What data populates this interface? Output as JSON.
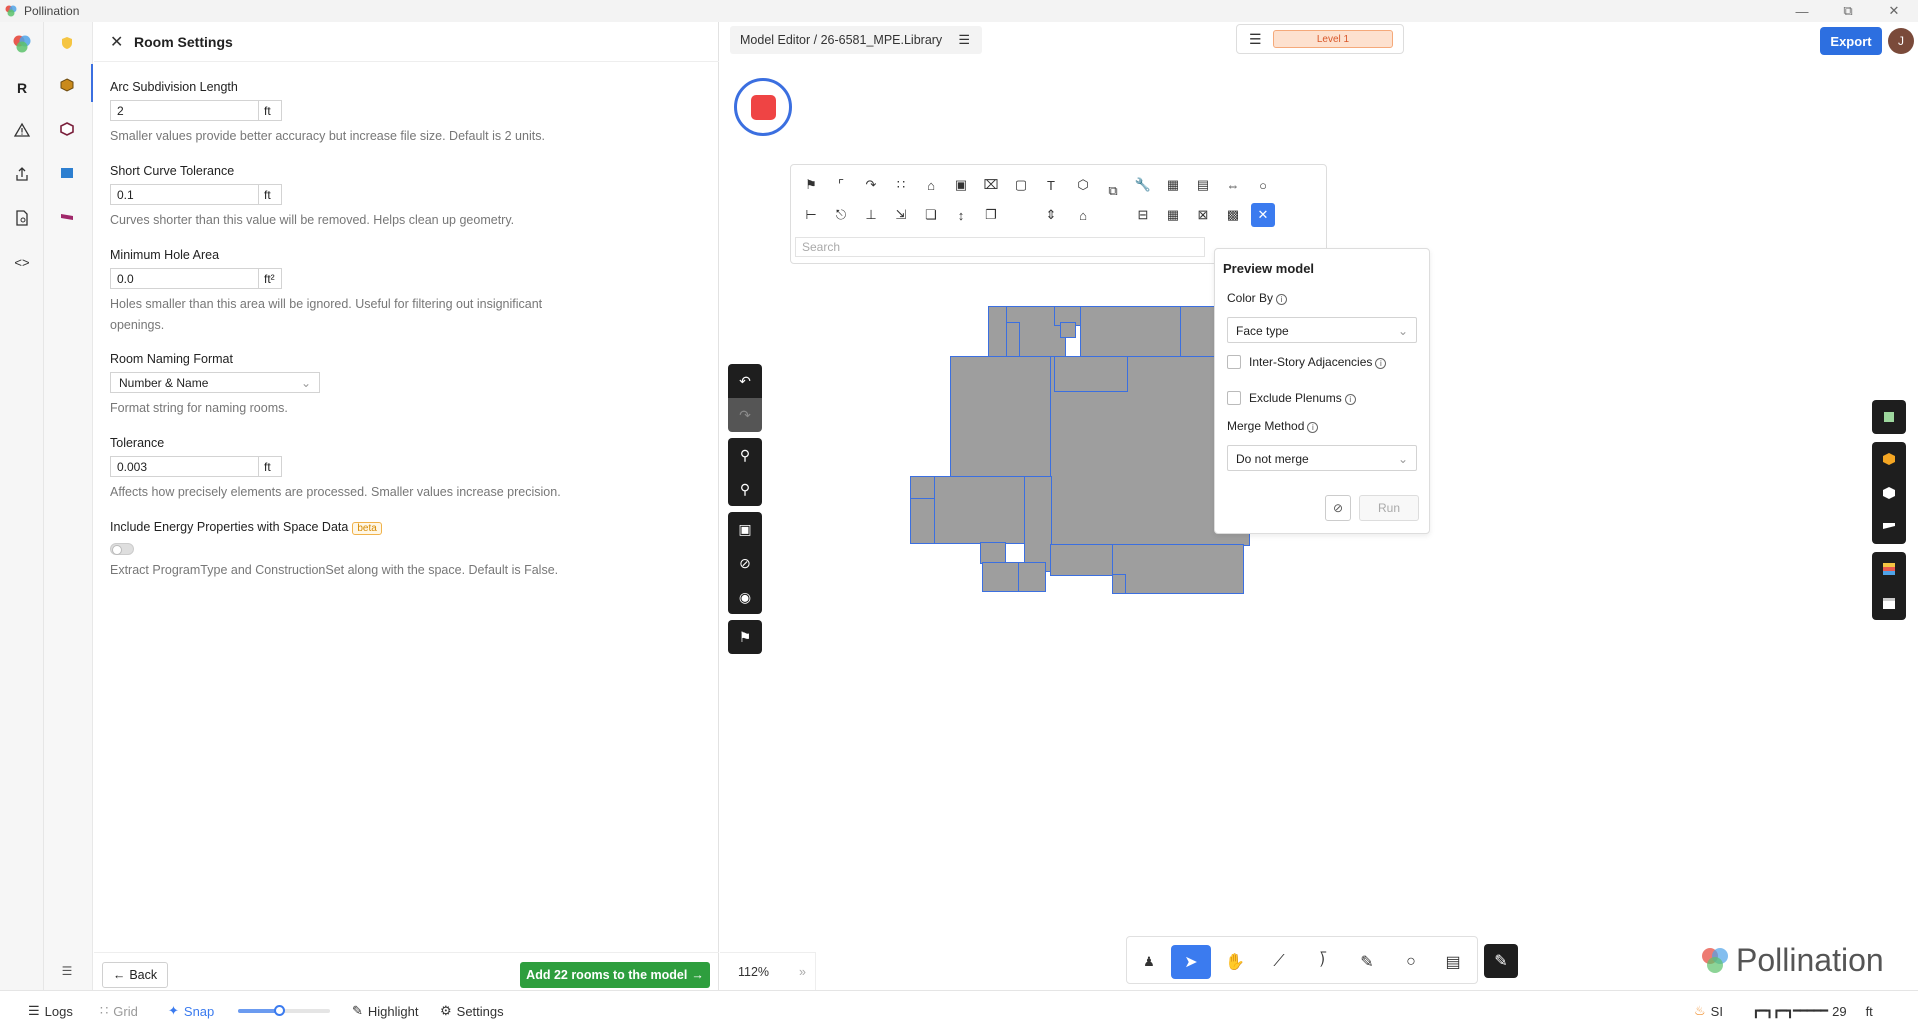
{
  "window": {
    "title": "Pollination",
    "controls": [
      "minimize-icon",
      "restore-icon",
      "close-icon"
    ]
  },
  "panel": {
    "title": "Room Settings",
    "fields": [
      {
        "label": "Arc Subdivision Length",
        "value": "2",
        "unit": "ft",
        "help": "Smaller values provide better accuracy but increase file size. Default is 2 units."
      },
      {
        "label": "Short Curve Tolerance",
        "value": "0.1",
        "unit": "ft",
        "help": "Curves shorter than this value will be removed. Helps clean up geometry."
      },
      {
        "label": "Minimum Hole Area",
        "value": "0.0",
        "unit": "ft²",
        "help": "Holes smaller than this area will be ignored. Useful for filtering out insignificant openings."
      },
      {
        "label": "Room Naming Format",
        "value": "Number & Name",
        "help": "Format string for naming rooms."
      },
      {
        "label": "Tolerance",
        "value": "0.003",
        "unit": "ft",
        "help": "Affects how precisely elements are processed. Smaller values increase precision."
      },
      {
        "label": "Include Energy Properties with Space Data",
        "badge": "beta",
        "help": "Extract ProgramType and ConstructionSet along with the space. Default is False."
      }
    ],
    "energy_toggle_on": false,
    "back_label": "Back",
    "add_label": "Add 22 rooms to the model"
  },
  "editor": {
    "breadcrumb": "Model Editor / 26-6581_MPE.Library",
    "level_label": "Level 1",
    "export_label": "Export",
    "avatar_initial": "J",
    "search_placeholder": "Search",
    "zoom": "112%"
  },
  "preview": {
    "title": "Preview model",
    "color_by_label": "Color By",
    "color_by_value": "Face type",
    "inter_story_label": "Inter-Story Adjacencies",
    "exclude_plenums_label": "Exclude Plenums",
    "merge_label": "Merge Method",
    "merge_value": "Do not merge",
    "run_label": "Run"
  },
  "brand": {
    "name": "Pollination"
  },
  "status": {
    "logs": "Logs",
    "grid": "Grid",
    "snap": "Snap",
    "highlight": "Highlight",
    "settings": "Settings",
    "units": "SI",
    "scale_value": "29",
    "scale_unit": "ft",
    "slider_fraction": 0.45
  },
  "colors": {
    "accent": "#3b7bef",
    "export": "#2d6fe0",
    "add_button": "#2e9e3e",
    "record": "#ef4444",
    "level_chip": "#fde1cf"
  }
}
